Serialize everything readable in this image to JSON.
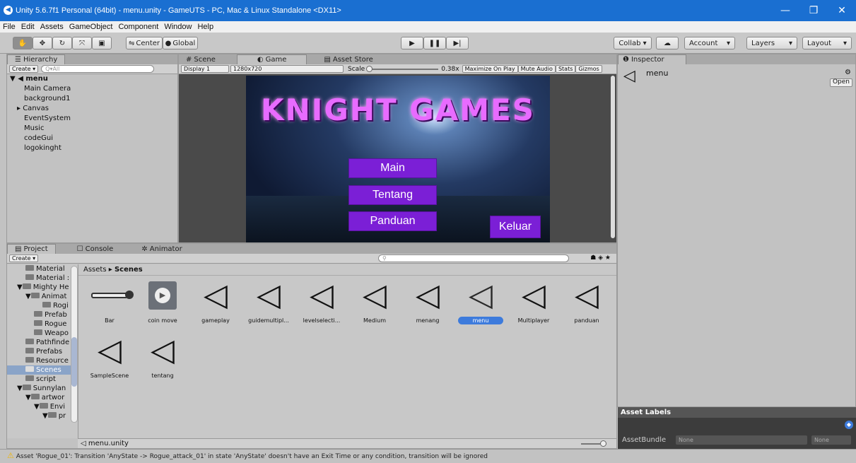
{
  "window": {
    "title": "Unity 5.6.7f1 Personal (64bit) - menu.unity - GameUTS - PC, Mac & Linux Standalone <DX11>",
    "minimize": "—",
    "restore": "❐",
    "close": "✕"
  },
  "menubar": [
    "File",
    "Edit",
    "Assets",
    "GameObject",
    "Component",
    "Window",
    "Help"
  ],
  "toolbar": {
    "center": "Center",
    "global": "Global",
    "collab": "Collab ▾",
    "account": "Account",
    "layers": "Layers",
    "layout": "Layout"
  },
  "hierarchy": {
    "tab": "Hierarchy",
    "create": "Create ▾",
    "search_placeholder": "Q▾All",
    "scene": "menu",
    "items": [
      "Main Camera",
      "background1",
      "Canvas",
      "EventSystem",
      "Music",
      "codeGui",
      "logokinght"
    ]
  },
  "center_tabs": {
    "scene": "Scene",
    "game": "Game",
    "asset_store": "Asset Store"
  },
  "game_bar": {
    "display": "Display 1",
    "resolution": "1280x720",
    "scale_label": "Scale",
    "scale_value": "0.38x",
    "maximize": "Maximize On Play",
    "mute": "Mute Audio",
    "stats": "Stats",
    "gizmos": "Gizmos"
  },
  "game_view": {
    "logo": "KNIGHT GAMES",
    "buttons": [
      "Main",
      "Tentang",
      "Panduan"
    ],
    "exit_button": "Keluar"
  },
  "inspector": {
    "tab": "Inspector",
    "object_name": "menu",
    "open": "Open",
    "asset_labels": "Asset Labels",
    "asset_bundle_label": "AssetBundle",
    "bundle_value": "None",
    "variant_value": "None"
  },
  "project": {
    "tabs": [
      "Project",
      "Console",
      "Animator"
    ],
    "create": "Create ▾",
    "breadcrumb_root": "Assets",
    "breadcrumb_current": "Scenes",
    "folders": [
      "Material",
      "Material :",
      "Mighty He",
      "Animat",
      "Rogi",
      "Prefab",
      "Rogue",
      "Weapo",
      "Pathfinde",
      "Prefabs",
      "Resource",
      "Scenes",
      "script",
      "Sunnylan",
      "artwor",
      "Envi",
      "pr"
    ],
    "assets": [
      "Bar",
      "coin move",
      "gameplay",
      "guidemultipl...",
      "levelselecti...",
      "Medium",
      "menang",
      "menu",
      "Multiplayer",
      "panduan",
      "SampleScene",
      "tentang"
    ],
    "footer_file": "menu.unity"
  },
  "status": {
    "message": "Asset 'Rogue_01': Transition 'AnyState -> Rogue_attack_01' in state 'AnyState' doesn't have an Exit Time or any condition, transition will be ignored"
  },
  "colors": {
    "title_bar": "#1a6fd1",
    "selection": "#3d7bdc",
    "menu_button": "#7b1fd6",
    "warning": "#f0b400"
  }
}
